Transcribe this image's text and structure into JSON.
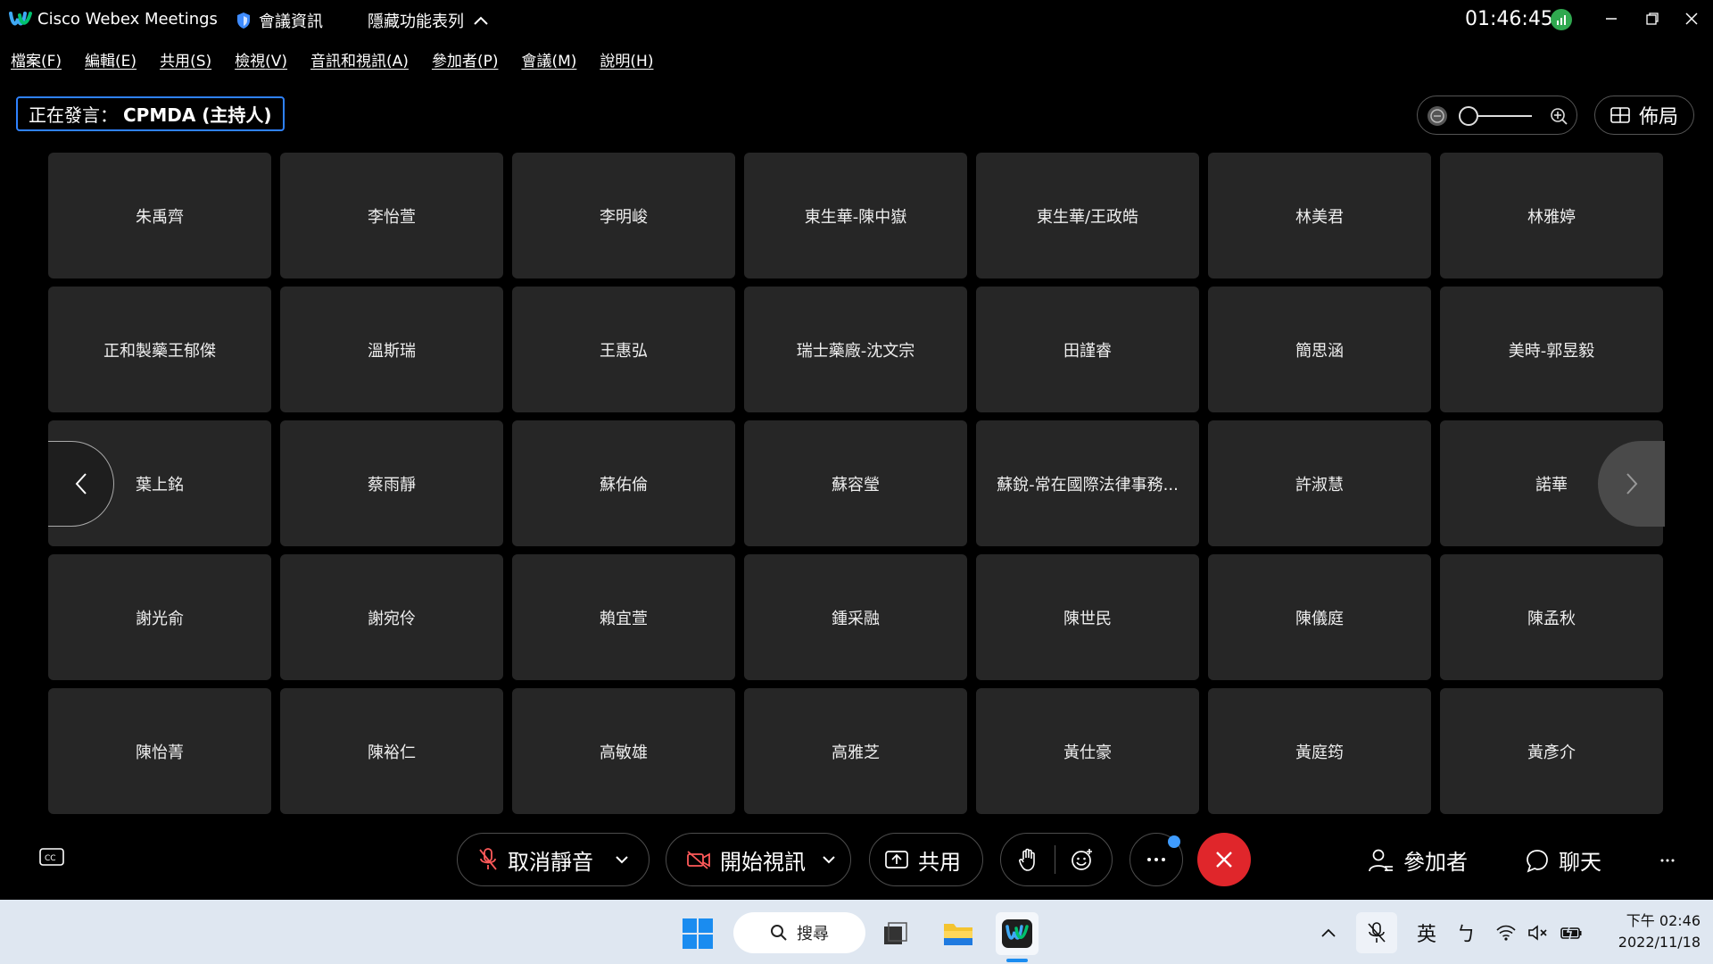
{
  "titlebar": {
    "app_name": "Cisco Webex Meetings",
    "meeting_info": "會議資訊",
    "hide_list": "隱藏功能表列",
    "clock": "01:46:45"
  },
  "menu": [
    {
      "label": "檔案",
      "key": "(F)"
    },
    {
      "label": "編輯",
      "key": "(E)"
    },
    {
      "label": "共用",
      "key": "(S)"
    },
    {
      "label": "檢視",
      "key": "(V)"
    },
    {
      "label": "音訊和視訊",
      "key": "(A)"
    },
    {
      "label": "參加者",
      "key": "(P)"
    },
    {
      "label": "會議",
      "key": "(M)"
    },
    {
      "label": "說明",
      "key": "(H)"
    }
  ],
  "speaker": {
    "prefix": "正在發言：",
    "name": "CPMDA (主持人)"
  },
  "layout_label": "佈局",
  "participants": [
    "朱禹齊",
    "李怡萱",
    "李明峻",
    "東生華-陳中嶽",
    "東生華/王政皓",
    "林美君",
    "林雅婷",
    "正和製藥王郁傑",
    "溫斯瑞",
    "王惠弘",
    "瑞士藥廠-沈文宗",
    "田謹睿",
    "簡思涵",
    "美時-郭昱毅",
    "葉上銘",
    "蔡雨靜",
    "蘇佑倫",
    "蘇容瑩",
    "蘇銳-常在國際法律事務...",
    "許淑慧",
    "諾華",
    "謝光俞",
    "謝宛伶",
    "賴宜萱",
    "鍾采融",
    "陳世民",
    "陳儀庭",
    "陳孟秋",
    "陳怡菁",
    "陳裕仁",
    "高敏雄",
    "高雅芝",
    "黃仕豪",
    "黃庭筠",
    "黃彥介"
  ],
  "controls": {
    "unmute": "取消靜音",
    "start_video": "開始視訊",
    "share": "共用",
    "participants": "參加者",
    "chat": "聊天"
  },
  "taskbar": {
    "search": "搜尋",
    "ime_lang": "英",
    "ime_mode": "ㄅ",
    "time": "下午 02:46",
    "date": "2022/11/18"
  },
  "colors": {
    "accent_blue": "#2f82ff",
    "leave_red": "#e0262b",
    "tile_bg": "#262626",
    "taskbar_bg": "#dfe7f1"
  }
}
